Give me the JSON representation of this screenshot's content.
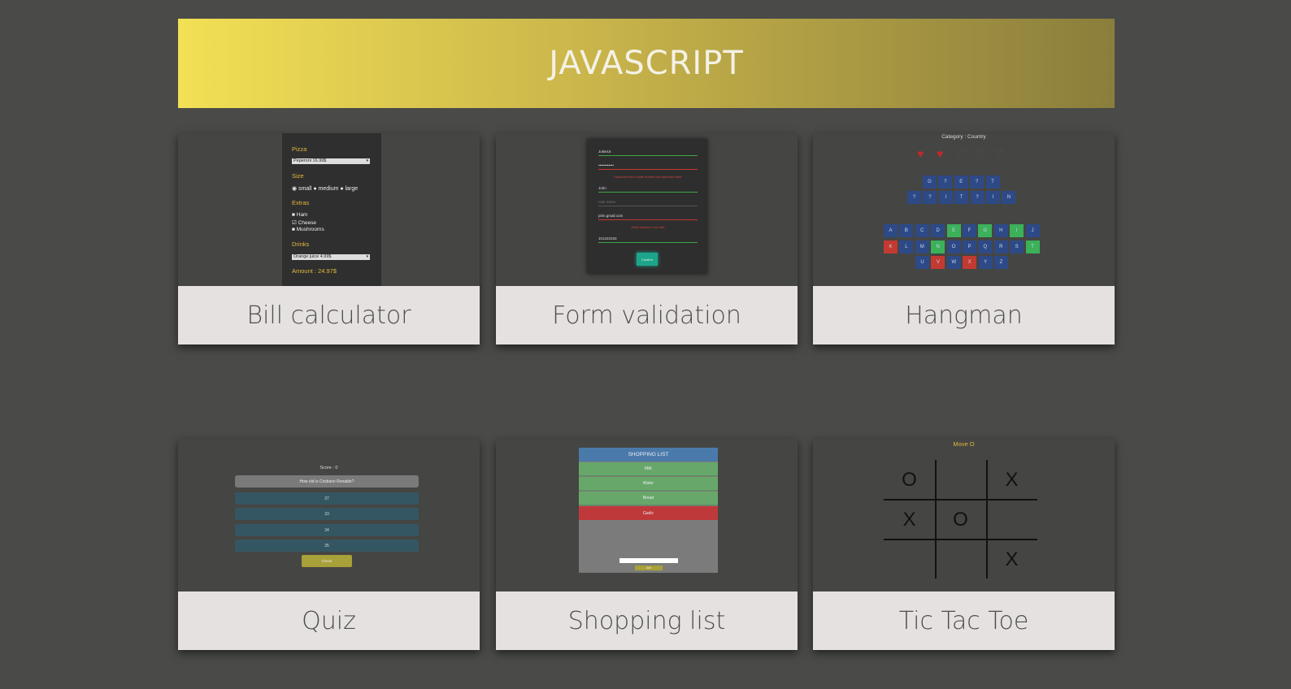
{
  "header": {
    "title": "JAVASCRIPT"
  },
  "cards": [
    {
      "title": "Bill calculator"
    },
    {
      "title": "Form validation"
    },
    {
      "title": "Hangman"
    },
    {
      "title": "Quiz"
    },
    {
      "title": "Shopping list"
    },
    {
      "title": "Tic Tac Toe"
    }
  ],
  "bill": {
    "pizza_label": "Pizza",
    "pizza_value": "Peperoni 16.99$",
    "size_label": "Size",
    "size_options": [
      "small",
      "medium",
      "large"
    ],
    "extras_label": "Extras",
    "extras": [
      "Ham",
      "Cheese",
      "Mushrooms"
    ],
    "drinks_label": "Drinks",
    "drinks_value": "Orange juice 4.99$",
    "amount": "Amount : 24.97$"
  },
  "form": {
    "username": "Jukie15",
    "password": "••••••••••••",
    "password_error": "Password must contain at least one uppercase letter",
    "first_name": "John",
    "last_name_placeholder": "Last name",
    "email": "john.gmail.com",
    "email_error": "Email address is not valid",
    "phone": "101222333",
    "submit": "Confirm"
  },
  "hangman": {
    "category": "Category : Country",
    "lives_full": 2,
    "lives_total": 5,
    "word_row1": [
      "G",
      "?",
      "E",
      "?",
      "T"
    ],
    "word_row2": [
      "?",
      "?",
      "I",
      "T",
      "?",
      "I",
      "N"
    ],
    "keyboard": [
      [
        "A",
        "B",
        "C",
        "D",
        "E",
        "F",
        "G",
        "H",
        "I",
        "J"
      ],
      [
        "K",
        "L",
        "M",
        "N",
        "O",
        "P",
        "Q",
        "R",
        "S",
        "T"
      ],
      [
        "U",
        "V",
        "W",
        "X",
        "Y",
        "Z"
      ]
    ],
    "correct_keys": [
      "E",
      "G",
      "I",
      "N",
      "T"
    ],
    "wrong_keys": [
      "K",
      "V",
      "X"
    ]
  },
  "quiz": {
    "score": "Score : 0",
    "question": "How old is Cristiano Ronaldo?",
    "answers": [
      "37",
      "33",
      "34",
      "35"
    ],
    "check": "Check"
  },
  "shopping": {
    "header": "SHOPPING LIST",
    "items": [
      {
        "name": "Milk",
        "status": "green"
      },
      {
        "name": "Water",
        "status": "green"
      },
      {
        "name": "Bread",
        "status": "green"
      },
      {
        "name": "Garlic",
        "status": "red"
      }
    ],
    "add": "Add"
  },
  "tictactoe": {
    "status": "Move O",
    "board": [
      "O",
      "",
      "X",
      "X",
      "O",
      "",
      "",
      "",
      "X"
    ]
  },
  "colors": {
    "background": "#4a4a48",
    "banner_start": "#f2e055",
    "banner_end": "#8a7e3c",
    "caption_bg": "#e6e1e1",
    "accent_yellow": "#e2b93a",
    "hangman_blue": "#2d4a87",
    "hangman_green": "#3bb15a",
    "hangman_red": "#c23a32"
  }
}
